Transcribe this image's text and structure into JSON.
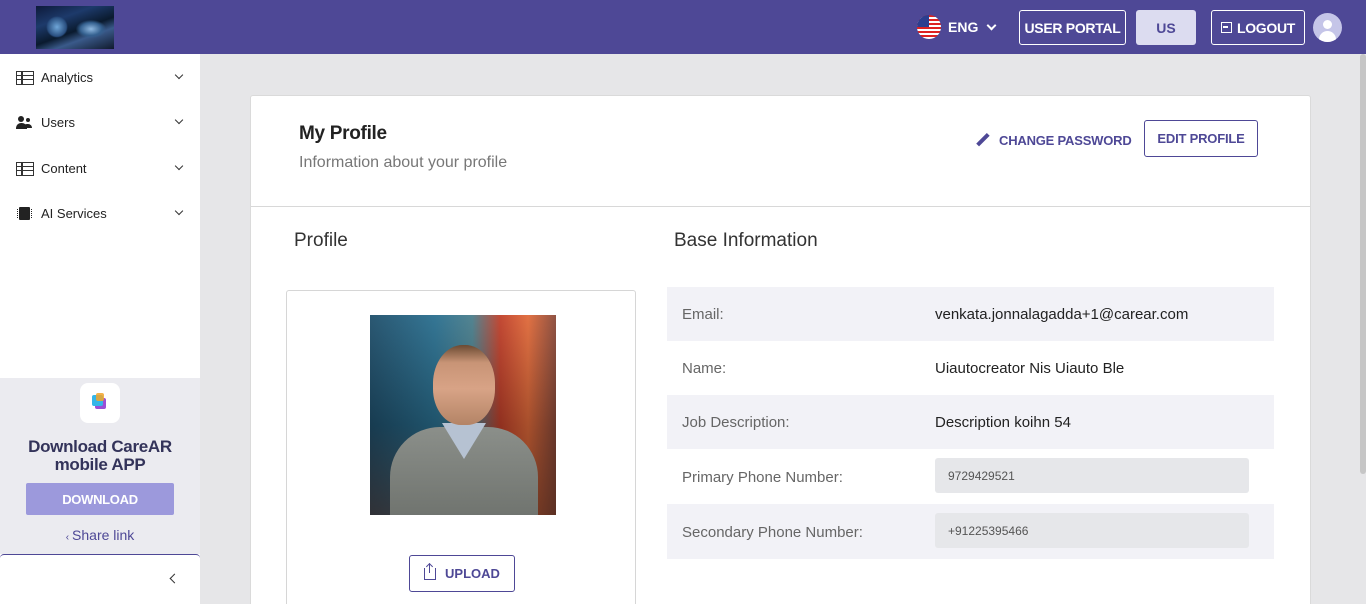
{
  "header": {
    "language": "ENG",
    "user_portal_label": "USER PORTAL",
    "region_label": "US",
    "logout_label": "LOGOUT",
    "brand_color": "#4e4896"
  },
  "sidebar": {
    "items": [
      {
        "label": "Analytics",
        "icon": "table-icon"
      },
      {
        "label": "Users",
        "icon": "users-icon"
      },
      {
        "label": "Content",
        "icon": "table-icon"
      },
      {
        "label": "AI Services",
        "icon": "chip-icon"
      }
    ],
    "promo": {
      "title_line1": "Download CareAR",
      "title_line2": "mobile APP",
      "download_label": "DOWNLOAD",
      "share_label": "Share link"
    }
  },
  "profile": {
    "title": "My Profile",
    "subtitle": "Information about your profile",
    "change_password_label": "CHANGE PASSWORD",
    "edit_profile_label": "EDIT PROFILE",
    "profile_section": "Profile",
    "base_section": "Base Information",
    "upload_label": "UPLOAD",
    "fields": {
      "email": {
        "label": "Email:",
        "value": "venkata.jonnalagadda+1@carear.com"
      },
      "name": {
        "label": "Name:",
        "value": "Uiautocreator Nis Uiauto Ble"
      },
      "job": {
        "label": "Job Description:",
        "value": "Description koihn 54"
      },
      "primary_phone": {
        "label": "Primary Phone Number:",
        "value": "9729429521"
      },
      "secondary_phone": {
        "label": "Secondary Phone Number:",
        "value": "+91225395466"
      }
    }
  }
}
